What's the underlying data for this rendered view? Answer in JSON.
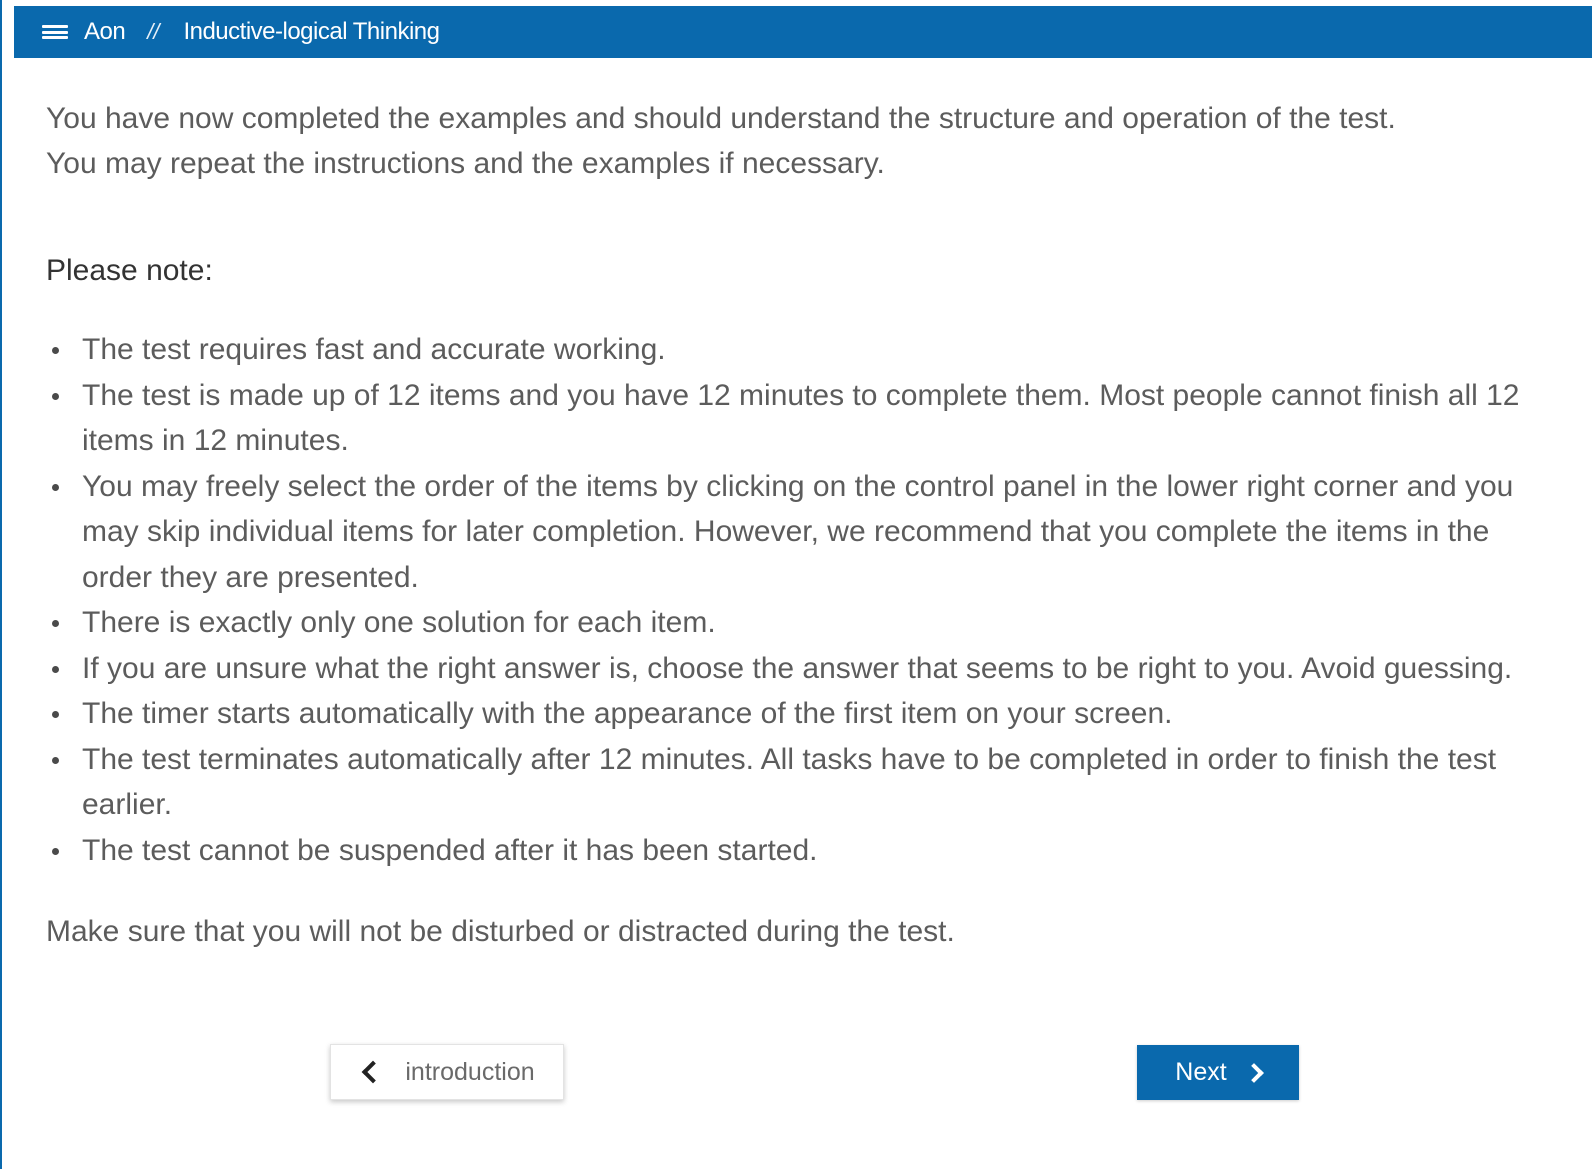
{
  "header": {
    "brand": "Aon",
    "separator": "//",
    "title": "Inductive-logical Thinking",
    "icon": "hamburger-menu-icon"
  },
  "main": {
    "intro": [
      "You have now completed the examples and should understand the structure and operation of the test.",
      "You may repeat the instructions and the examples if necessary."
    ],
    "note_heading": "Please note:",
    "rules": [
      "The test requires fast and accurate working.",
      "The test is made up of 12 items and you have 12 minutes to complete them. Most people cannot finish all 12 items in 12 minutes.",
      "You may freely select the order of the items by clicking on the control panel in the lower right corner and you may skip individual items for later completion. However, we recommend that you complete the items in the order they are presented.",
      "There is exactly only one solution for each item.",
      "If you are unsure what the right answer is, choose the answer that seems to be right to you. Avoid guessing.",
      "The timer starts automatically with the appearance of the first item on your screen.",
      "The test terminates automatically after 12 minutes. All tasks have to be completed in order to finish the test earlier.",
      "The test cannot be suspended after it has been started."
    ],
    "outro": "Make sure that you will not be disturbed or distracted during the test."
  },
  "nav": {
    "back_label": "introduction",
    "back_icon": "chevron-left-icon",
    "next_label": "Next",
    "next_icon": "chevron-right-icon"
  },
  "colors": {
    "accent": "#0a69ad",
    "text": "#5c5c5c"
  }
}
